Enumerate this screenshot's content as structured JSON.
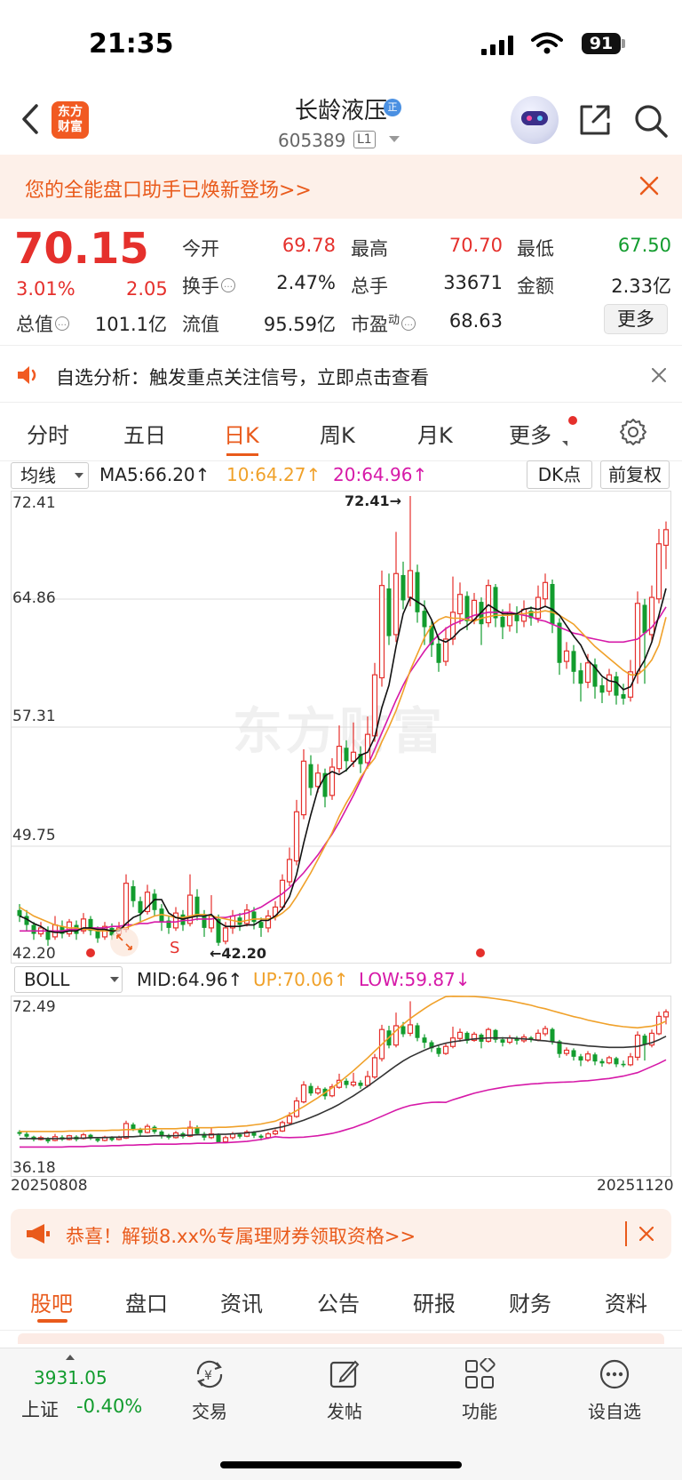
{
  "status_bar": {
    "time": "21:35",
    "battery": "91"
  },
  "header": {
    "logo_line1": "东方",
    "logo_line2": "财富",
    "stock_name": "长龄液压",
    "badge": "正",
    "stock_code": "605389",
    "level": "L1"
  },
  "assistant_banner": {
    "text": "您的全能盘口助手已焕新登场>>"
  },
  "quote": {
    "price": "70.15",
    "change_pct": "3.01%",
    "change_amt": "2.05",
    "open_label": "今开",
    "open": "69.78",
    "high_label": "最高",
    "high": "70.70",
    "low_label": "最低",
    "low": "67.50",
    "turnover_label": "换手",
    "turnover": "2.47%",
    "volume_label": "总手",
    "volume": "33671",
    "amount_label": "金额",
    "amount": "2.33亿",
    "mktcap_label": "总值",
    "mktcap": "101.1亿",
    "float_label": "流值",
    "float": "95.59亿",
    "pe_label": "市盈",
    "pe_sup": "动",
    "pe": "68.63",
    "more_label": "更多",
    "colors": {
      "up": "#e5302c",
      "down": "#129c2e"
    }
  },
  "alert": {
    "text": "自选分析：触发重点关注信号，立即点击查看"
  },
  "period_tabs": [
    "分时",
    "五日",
    "日K",
    "周K",
    "月K",
    "更多"
  ],
  "active_period": "日K",
  "main_indicator": {
    "selector": "均线",
    "ma5": "MA5:66.20↑",
    "ma10": "10:64.27↑",
    "ma20": "20:64.96↑",
    "dk_button": "DK点",
    "adjust_button": "前复权"
  },
  "sub_indicator": {
    "selector": "BOLL",
    "mid": "MID:64.96↑",
    "up": "UP:70.06↑",
    "low": "LOW:59.87↓"
  },
  "chart_data": {
    "type": "candlestick",
    "main_y_ticks": [
      "72.41",
      "64.86",
      "57.31",
      "49.75",
      "42.20"
    ],
    "main_ylim": [
      42.2,
      72.41
    ],
    "high_annotation": "72.41→",
    "low_annotation": "←42.20",
    "signal_label": "S",
    "sub_y_ticks": [
      "72.49",
      "36.18"
    ],
    "sub_ylim": [
      36.18,
      72.49
    ],
    "x_start": "20250808",
    "x_end": "20251120",
    "ma_colors": {
      "ma5": "#111111",
      "ma10": "#f0a12a",
      "ma20": "#d619a8"
    },
    "candles": [
      [
        44.6,
        44.2,
        45.0,
        43.8
      ],
      [
        44.2,
        43.6,
        44.6,
        43.2
      ],
      [
        43.6,
        43.0,
        43.8,
        42.6
      ],
      [
        43.0,
        43.4,
        43.8,
        42.8
      ],
      [
        43.2,
        42.6,
        43.5,
        42.2
      ],
      [
        42.8,
        43.6,
        44.2,
        42.6
      ],
      [
        43.5,
        43.0,
        43.9,
        42.7
      ],
      [
        43.0,
        43.8,
        44.0,
        42.8
      ],
      [
        43.6,
        43.0,
        43.9,
        42.6
      ],
      [
        43.2,
        44.0,
        44.4,
        43.0
      ],
      [
        44.0,
        43.2,
        44.2,
        42.9
      ],
      [
        43.2,
        42.7,
        43.5,
        42.4
      ],
      [
        42.8,
        43.5,
        43.8,
        42.6
      ],
      [
        43.4,
        42.9,
        43.7,
        42.6
      ],
      [
        43.0,
        43.4,
        43.8,
        42.8
      ],
      [
        43.3,
        46.4,
        47.0,
        43.1
      ],
      [
        46.2,
        45.2,
        46.6,
        44.8
      ],
      [
        45.2,
        44.4,
        45.5,
        43.8
      ],
      [
        44.5,
        45.8,
        46.3,
        44.3
      ],
      [
        45.7,
        44.6,
        46.0,
        44.2
      ],
      [
        44.7,
        43.8,
        45.0,
        43.2
      ],
      [
        43.9,
        43.4,
        44.2,
        43.0
      ],
      [
        43.4,
        44.4,
        44.8,
        43.2
      ],
      [
        44.3,
        43.6,
        44.6,
        43.2
      ],
      [
        43.7,
        45.6,
        47.0,
        43.5
      ],
      [
        45.5,
        44.2,
        46.0,
        43.9
      ],
      [
        44.2,
        43.4,
        44.6,
        42.8
      ],
      [
        43.4,
        44.2,
        45.6,
        43.1
      ],
      [
        44.0,
        42.4,
        44.3,
        42.2
      ],
      [
        42.5,
        43.4,
        43.8,
        42.3
      ],
      [
        43.4,
        44.2,
        44.6,
        43.0
      ],
      [
        44.1,
        43.6,
        44.4,
        43.2
      ],
      [
        43.7,
        44.6,
        45.0,
        43.5
      ],
      [
        44.5,
        43.8,
        44.8,
        43.3
      ],
      [
        43.8,
        43.4,
        44.1,
        42.8
      ],
      [
        43.4,
        44.2,
        44.6,
        43.1
      ],
      [
        44.2,
        44.8,
        45.2,
        43.9
      ],
      [
        44.8,
        46.6,
        47.0,
        44.6
      ],
      [
        46.5,
        48.0,
        48.8,
        46.2
      ],
      [
        47.9,
        51.2,
        52.0,
        47.6
      ],
      [
        51.0,
        54.6,
        55.4,
        50.7
      ],
      [
        54.4,
        52.8,
        55.0,
        52.3
      ],
      [
        52.9,
        53.8,
        54.4,
        52.5
      ],
      [
        53.8,
        52.2,
        54.1,
        51.5
      ],
      [
        52.3,
        54.2,
        54.8,
        52.0
      ],
      [
        54.1,
        55.6,
        57.0,
        53.8
      ],
      [
        55.5,
        54.6,
        56.0,
        53.9
      ],
      [
        54.6,
        55.2,
        57.2,
        54.2
      ],
      [
        55.1,
        54.4,
        55.6,
        53.8
      ],
      [
        54.5,
        56.4,
        57.6,
        54.1
      ],
      [
        56.3,
        60.4,
        61.2,
        55.9
      ],
      [
        60.2,
        66.4,
        67.4,
        59.6
      ],
      [
        66.2,
        63.0,
        67.2,
        62.4
      ],
      [
        63.1,
        67.2,
        70.0,
        62.6
      ],
      [
        67.1,
        65.4,
        68.0,
        64.8
      ],
      [
        65.6,
        67.4,
        72.41,
        65.0
      ],
      [
        67.3,
        64.6,
        67.8,
        63.9
      ],
      [
        64.7,
        63.6,
        65.4,
        62.4
      ],
      [
        63.7,
        62.4,
        64.1,
        61.6
      ],
      [
        62.5,
        61.2,
        63.0,
        60.6
      ],
      [
        61.3,
        62.8,
        63.6,
        61.0
      ],
      [
        62.8,
        64.6,
        67.0,
        62.4
      ],
      [
        64.5,
        65.8,
        66.6,
        63.8
      ],
      [
        65.7,
        64.0,
        66.0,
        63.4
      ],
      [
        64.1,
        65.4,
        65.9,
        63.8
      ],
      [
        65.3,
        63.8,
        65.6,
        62.4
      ],
      [
        63.9,
        66.4,
        66.8,
        63.6
      ],
      [
        66.3,
        64.2,
        66.5,
        63.6
      ],
      [
        64.3,
        63.6,
        64.8,
        62.8
      ],
      [
        63.7,
        64.6,
        65.2,
        63.3
      ],
      [
        64.5,
        64.0,
        65.0,
        63.2
      ],
      [
        64.0,
        64.8,
        65.4,
        63.6
      ],
      [
        64.7,
        64.2,
        65.0,
        63.7
      ],
      [
        64.2,
        65.6,
        66.4,
        63.9
      ],
      [
        65.5,
        66.6,
        67.2,
        65.0
      ],
      [
        66.5,
        63.8,
        66.8,
        63.2
      ],
      [
        63.9,
        61.2,
        64.2,
        60.4
      ],
      [
        61.3,
        62.0,
        62.6,
        60.8
      ],
      [
        62.0,
        60.6,
        62.4,
        59.8
      ],
      [
        60.7,
        59.8,
        61.2,
        58.6
      ],
      [
        59.9,
        61.2,
        61.8,
        59.5
      ],
      [
        61.1,
        59.6,
        61.5,
        58.8
      ],
      [
        59.7,
        59.2,
        60.2,
        58.5
      ],
      [
        59.3,
        60.4,
        60.8,
        59.0
      ],
      [
        60.3,
        59.0,
        60.6,
        58.4
      ],
      [
        59.1,
        58.8,
        59.8,
        58.4
      ],
      [
        58.9,
        60.6,
        61.4,
        58.6
      ],
      [
        60.5,
        65.2,
        66.0,
        59.8
      ],
      [
        65.1,
        63.2,
        65.5,
        59.8
      ],
      [
        63.1,
        65.6,
        66.4,
        62.6
      ],
      [
        65.5,
        69.2,
        70.2,
        65.2
      ],
      [
        69.1,
        70.15,
        70.7,
        67.5
      ]
    ],
    "ma5": [
      44.2,
      44.0,
      43.7,
      43.5,
      43.2,
      43.1,
      43.1,
      43.2,
      43.2,
      43.4,
      43.4,
      43.3,
      43.3,
      43.2,
      43.2,
      43.7,
      44.1,
      44.3,
      44.8,
      45.3,
      45.3,
      44.4,
      44.1,
      44.0,
      44.1,
      44.2,
      44.2,
      44.3,
      43.8,
      43.5,
      43.5,
      43.5,
      43.6,
      43.6,
      43.9,
      43.9,
      44.2,
      44.7,
      45.5,
      47.0,
      49.1,
      51.0,
      52.7,
      53.6,
      53.9,
      53.7,
      54.0,
      54.5,
      55.0,
      55.2,
      56.2,
      58.2,
      59.7,
      62.3,
      64.5,
      65.6,
      65.3,
      65.0,
      64.1,
      62.8,
      62.6,
      62.9,
      63.4,
      63.7,
      64.1,
      64.6,
      65.1,
      64.8,
      64.5,
      64.5,
      64.5,
      64.8,
      64.9,
      64.8,
      65.0,
      64.8,
      64.4,
      63.7,
      63.0,
      62.4,
      61.4,
      60.9,
      60.3,
      60.0,
      59.9,
      59.4,
      59.6,
      60.6,
      61.4,
      62.6,
      64.4,
      66.2
    ],
    "ma10": [
      44.8,
      44.5,
      44.2,
      44.0,
      43.8,
      43.6,
      43.5,
      43.4,
      43.4,
      43.3,
      43.3,
      43.2,
      43.2,
      43.2,
      43.3,
      43.4,
      43.6,
      43.8,
      44.0,
      44.2,
      44.3,
      44.2,
      44.1,
      44.1,
      44.2,
      44.3,
      44.3,
      44.2,
      44.1,
      44.0,
      43.9,
      43.8,
      43.9,
      44.0,
      44.0,
      44.0,
      44.1,
      44.4,
      44.8,
      45.5,
      46.3,
      47.1,
      48.0,
      48.9,
      49.8,
      50.9,
      51.8,
      52.6,
      53.5,
      54.2,
      54.8,
      55.9,
      56.9,
      58.0,
      59.3,
      60.7,
      61.8,
      62.9,
      63.7,
      64.1,
      64.3,
      64.2,
      64.2,
      64.1,
      64.0,
      64.2,
      64.3,
      64.4,
      64.4,
      64.4,
      64.5,
      64.5,
      64.6,
      64.6,
      64.7,
      64.6,
      64.4,
      64.1,
      63.8,
      63.3,
      62.8,
      62.3,
      61.9,
      61.5,
      61.1,
      60.7,
      60.4,
      60.4,
      60.8,
      61.4,
      62.4,
      64.27
    ],
    "ma20": [
      43.2,
      43.2,
      43.2,
      43.2,
      43.2,
      43.2,
      43.2,
      43.3,
      43.3,
      43.3,
      43.4,
      43.4,
      43.4,
      43.5,
      43.5,
      43.6,
      43.6,
      43.7,
      43.7,
      43.8,
      43.8,
      43.8,
      43.8,
      43.9,
      43.9,
      44.0,
      44.0,
      44.0,
      44.1,
      44.1,
      44.2,
      44.3,
      44.4,
      44.6,
      44.8,
      45.1,
      45.4,
      45.7,
      46.1,
      46.6,
      47.1,
      47.7,
      48.3,
      49.0,
      49.7,
      50.5,
      51.4,
      52.3,
      53.3,
      54.3,
      55.4,
      56.5,
      57.6,
      58.7,
      59.7,
      60.6,
      61.3,
      62.0,
      62.6,
      63.1,
      63.5,
      63.8,
      64.0,
      64.2,
      64.4,
      64.5,
      64.6,
      64.6,
      64.6,
      64.6,
      64.5,
      64.4,
      64.3,
      64.1,
      64.0,
      63.8,
      63.6,
      63.4,
      63.2,
      63.1,
      62.9,
      62.8,
      62.7,
      62.6,
      62.6,
      62.6,
      62.7,
      62.8,
      63.2,
      63.6,
      64.2,
      64.96
    ],
    "boll_mid_note": "MID equals MA20"
  },
  "promo_banner": {
    "text": "恭喜！解锁8.xx%专属理财券领取资格>>"
  },
  "section_tabs": [
    "股吧",
    "盘口",
    "资讯",
    "公告",
    "研报",
    "财务",
    "资料"
  ],
  "active_section": "股吧",
  "bottom_nav": {
    "index_value": "3931.05",
    "index_name": "上证",
    "index_change": "-0.40%",
    "items": [
      "交易",
      "发帖",
      "功能",
      "设自选"
    ]
  },
  "watermark": "东方财富"
}
